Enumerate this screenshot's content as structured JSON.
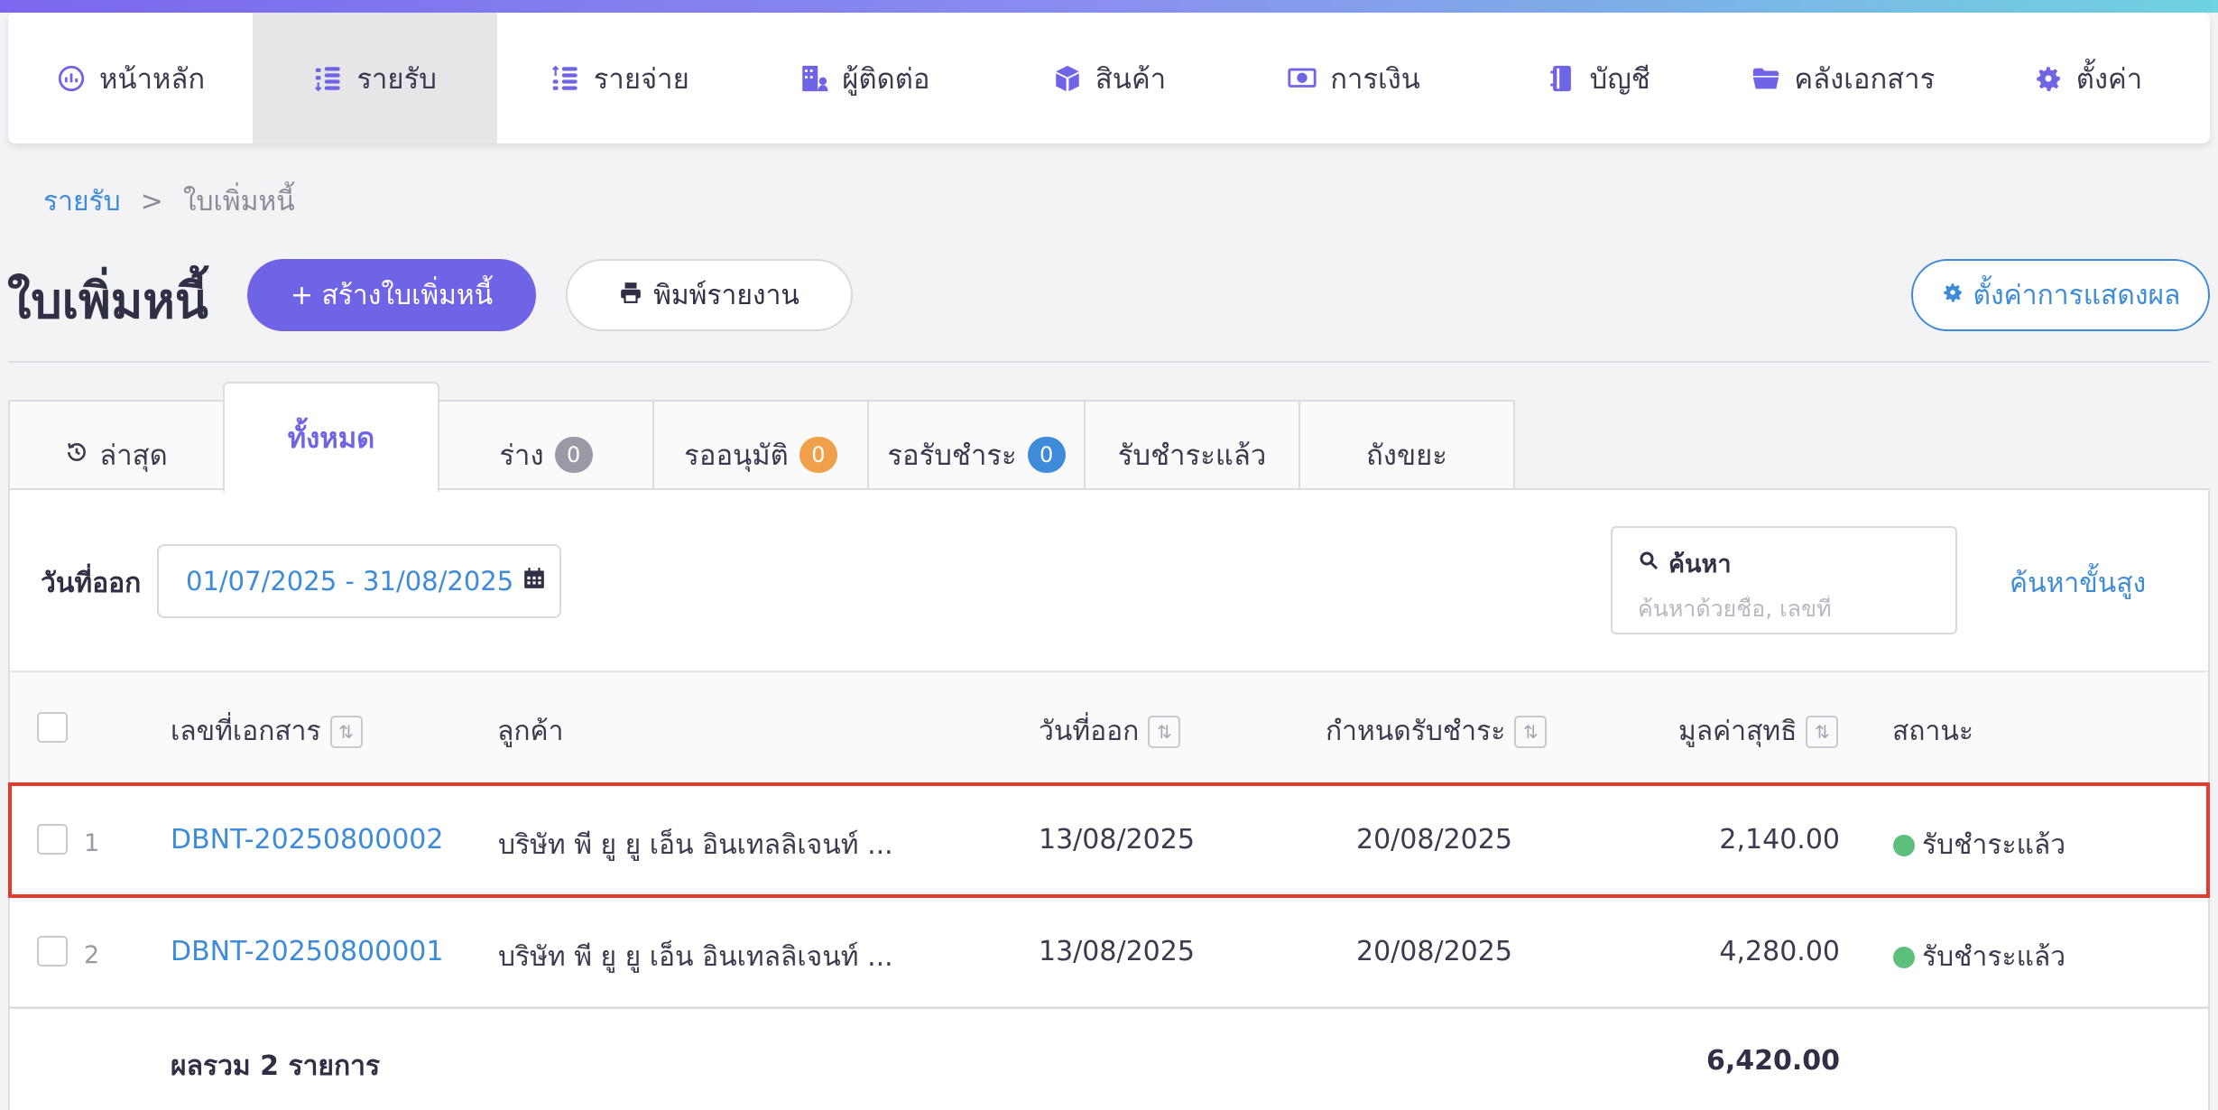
{
  "nav": {
    "items": [
      {
        "label": "หน้าหลัก",
        "icon": "dashboard-icon"
      },
      {
        "label": "รายรับ",
        "icon": "coins-in-icon"
      },
      {
        "label": "รายจ่าย",
        "icon": "coins-out-icon"
      },
      {
        "label": "ผู้ติดต่อ",
        "icon": "building-contact-icon"
      },
      {
        "label": "สินค้า",
        "icon": "box-icon"
      },
      {
        "label": "การเงิน",
        "icon": "money-icon"
      },
      {
        "label": "บัญชี",
        "icon": "ledger-icon"
      },
      {
        "label": "คลังเอกสาร",
        "icon": "folder-icon"
      },
      {
        "label": "ตั้งค่า",
        "icon": "gear-icon"
      }
    ],
    "active_index": 1
  },
  "breadcrumb": {
    "parent": "รายรับ",
    "separator": ">",
    "current": "ใบเพิ่มหนี้"
  },
  "page": {
    "title": "ใบเพิ่มหนี้",
    "create_label": "+ สร้างใบเพิ่มหนี้",
    "print_label": "พิมพ์รายงาน",
    "display_settings_label": "ตั้งค่าการแสดงผล"
  },
  "tabs": [
    {
      "label": "ล่าสุด",
      "icon": "history-icon"
    },
    {
      "label": "ทั้งหมด"
    },
    {
      "label": "ร่าง",
      "badge": "0",
      "badge_color": "#9a9aa6"
    },
    {
      "label": "รออนุมัติ",
      "badge": "0",
      "badge_color": "#f0a04b"
    },
    {
      "label": "รอรับชำระ",
      "badge": "0",
      "badge_color": "#3d8bd9"
    },
    {
      "label": "รับชำระแล้ว"
    },
    {
      "label": "ถังขยะ"
    }
  ],
  "active_tab_index": 1,
  "filter": {
    "date_label": "วันที่ออก",
    "date_range": "01/07/2025 - 31/08/2025",
    "search_title": "ค้นหา",
    "search_placeholder": "ค้นหาด้วยชื่อ, เลขที่",
    "advanced_search_label": "ค้นหาขั้นสูง"
  },
  "table": {
    "columns": {
      "doc_no": "เลขที่เอกสาร",
      "customer": "ลูกค้า",
      "issue_date": "วันที่ออก",
      "due_date": "กำหนดรับชำระ",
      "net_value": "มูลค่าสุทธิ",
      "status": "สถานะ"
    },
    "rows": [
      {
        "num": "1",
        "doc_no": "DBNT-20250800002",
        "customer": "บริษัท พี ยู ยู เอ็น อินเทลลิเจนท์ ...",
        "issue_date": "13/08/2025",
        "due_date": "20/08/2025",
        "net_value": "2,140.00",
        "status": "รับชำระแล้ว"
      },
      {
        "num": "2",
        "doc_no": "DBNT-20250800001",
        "customer": "บริษัท พี ยู ยู เอ็น อินเทลลิเจนท์ ...",
        "issue_date": "13/08/2025",
        "due_date": "20/08/2025",
        "net_value": "4,280.00",
        "status": "รับชำระแล้ว"
      }
    ],
    "highlighted_row_index": 0,
    "total_label": "ผลรวม 2 รายการ",
    "total_value": "6,420.00"
  },
  "colors": {
    "accent": "#6f63e6",
    "link": "#3d8bd9",
    "status_paid": "#5cbf7a",
    "highlight_border": "#e53a2c"
  }
}
